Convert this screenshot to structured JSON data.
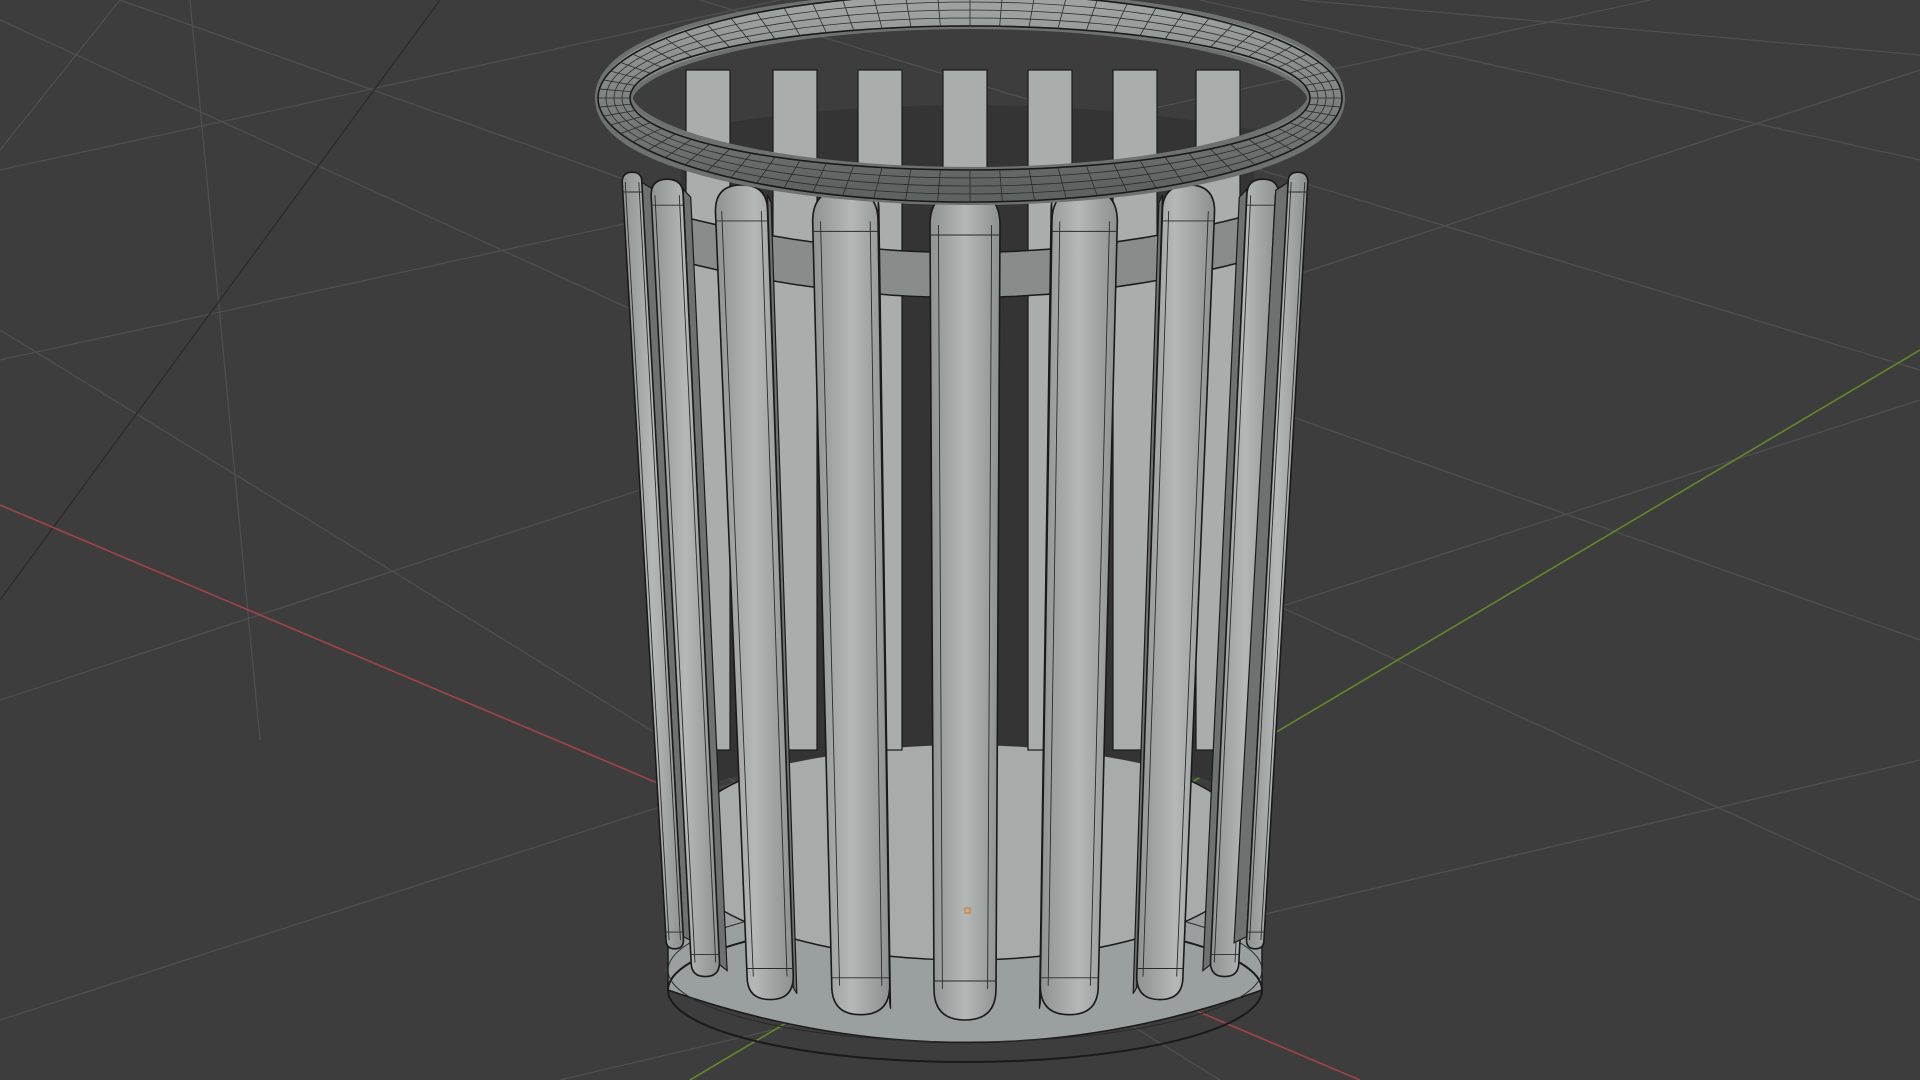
{
  "viewport": {
    "background_color": "#3d3d3d",
    "grid_color": "#4d4d4d",
    "x_axis_color": "#b5484c",
    "y_axis_color": "#6f9a2a",
    "mesh_color": "#a3a8a7",
    "wire_color": "#1a1a1a",
    "origin_marker_color": "#e07a2a"
  },
  "scene": {
    "object": "trash-bin-mesh",
    "shading": "solid",
    "overlay": "wireframe",
    "slat_count": 16
  }
}
